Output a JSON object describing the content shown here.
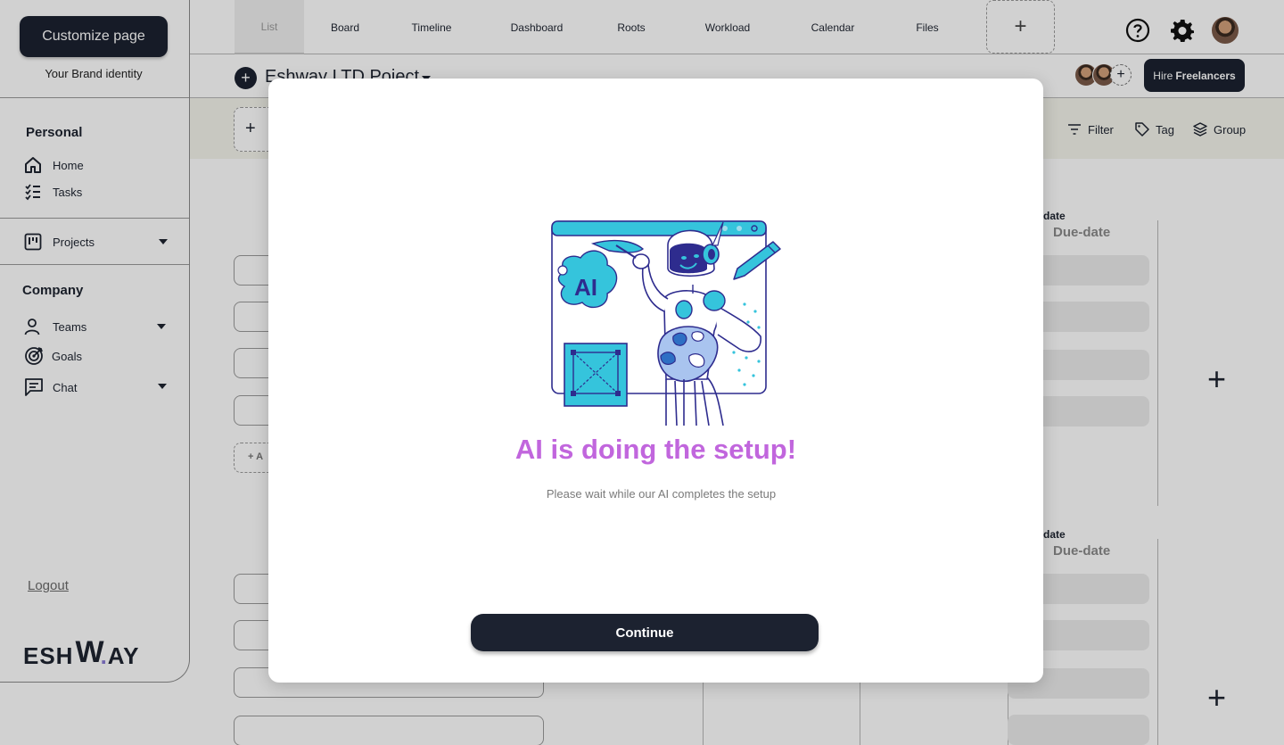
{
  "sidebar": {
    "customize_label": "Customize page",
    "brand_identity": "Your Brand identity",
    "personal_title": "Personal",
    "home_label": "Home",
    "tasks_label": "Tasks",
    "projects_label": "Projects",
    "company_title": "Company",
    "teams_label": "Teams",
    "goals_label": "Goals",
    "chat_label": "Chat",
    "logout_label": "Logout",
    "logo": {
      "part1": "ESH",
      "w": "W",
      "dot": ".",
      "part2": "AY"
    }
  },
  "tabs": [
    "List",
    "Board",
    "Timeline",
    "Dashboard",
    "Roots",
    "Workload",
    "Calendar",
    "Files"
  ],
  "add_tab_symbol": "+",
  "header": {
    "add_symbol": "+",
    "project_title": "Eshway  LTD Poject",
    "avatar_add_symbol": "+",
    "hire_prefix": "Hire",
    "hire_bold": "Freelancers"
  },
  "toolbar": {
    "add_symbol": "+",
    "filter_label": "Filter",
    "tag_label": "Tag",
    "group_label": "Group"
  },
  "table": {
    "due_date_small": "-date",
    "due_date_header": "Due-date",
    "add_row_label": "+ A",
    "plus_symbol": "+"
  },
  "modal": {
    "ai_badge": "AI",
    "title": "AI is doing the setup!",
    "subtitle": "Please wait while our AI completes the setup",
    "continue_label": "Continue"
  },
  "colors": {
    "primary_dark": "#1c2230",
    "accent_purple": "#c166dd",
    "illustration_cyan": "#35c4dc",
    "illustration_navy": "#2e2c8e"
  }
}
